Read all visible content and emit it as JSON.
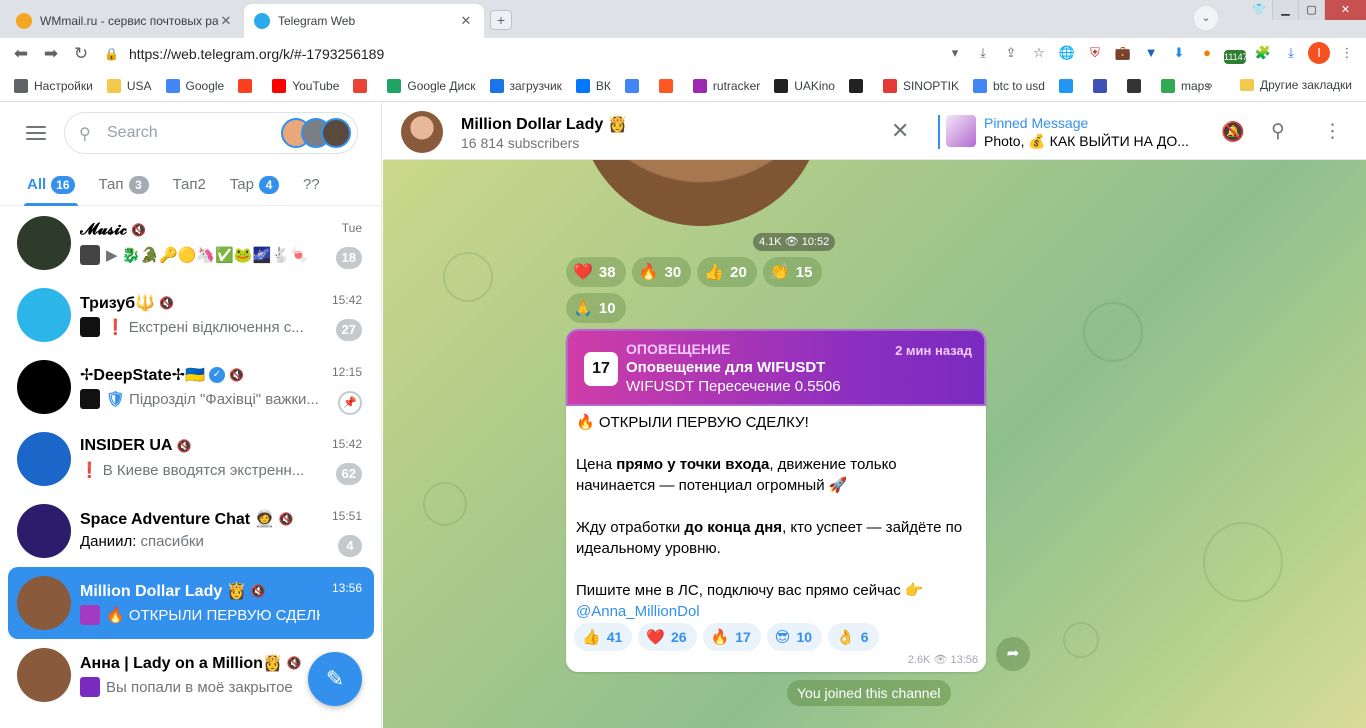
{
  "browser": {
    "tabs": [
      {
        "title": "WMmail.ru - сервис почтовых рас",
        "color": "#f5a623"
      },
      {
        "title": "Telegram Web",
        "color": "#2aabee"
      }
    ],
    "url": "https://web.telegram.org/k/#-1793256189",
    "ext_badge": "11147",
    "bookmarks": [
      {
        "label": "Настройки",
        "icon": "gear-icon",
        "color": "#5f6368"
      },
      {
        "label": "USA",
        "icon": "folder-icon",
        "color": "#f2c94c"
      },
      {
        "label": "Google",
        "icon": "google-icon",
        "color": "#4285f4"
      },
      {
        "label": "",
        "icon": "yandex-icon",
        "color": "#fc3f1d"
      },
      {
        "label": "YouTube",
        "icon": "youtube-icon",
        "color": "#ff0000"
      },
      {
        "label": "",
        "icon": "gmail-icon",
        "color": "#ea4335"
      },
      {
        "label": "Google Диск",
        "icon": "drive-icon",
        "color": "#1fa463"
      },
      {
        "label": "загрузчик",
        "icon": "loader-icon",
        "color": "#1a73e8"
      },
      {
        "label": "ВК",
        "icon": "vk-icon",
        "color": "#0077ff"
      },
      {
        "label": "",
        "icon": "translate-icon",
        "color": "#4285f4"
      },
      {
        "label": "",
        "icon": "f-icon",
        "color": "#ff5722"
      },
      {
        "label": "rutracker",
        "icon": "rutracker-icon",
        "color": "#9c27b0"
      },
      {
        "label": "UAKino",
        "icon": "film-icon",
        "color": "#222222"
      },
      {
        "label": "",
        "icon": "chess-icon",
        "color": "#222222"
      },
      {
        "label": "SINOPTIK",
        "icon": "thermo-icon",
        "color": "#e53935"
      },
      {
        "label": "btc to usd",
        "icon": "google-icon",
        "color": "#4285f4"
      },
      {
        "label": "",
        "icon": "p-icon",
        "color": "#2196f3"
      },
      {
        "label": "",
        "icon": "k-icon",
        "color": "#3f51b5"
      },
      {
        "label": "",
        "icon": "bc-icon",
        "color": "#333333"
      },
      {
        "label": "maps",
        "icon": "maps-icon",
        "color": "#34a853"
      }
    ],
    "more_label": "»",
    "other_bookmarks": "Другие закладки"
  },
  "sidebar": {
    "search_placeholder": "Search",
    "folders": [
      {
        "label": "All",
        "badge": "16",
        "active": true
      },
      {
        "label": "Тап",
        "badge": "3"
      },
      {
        "label": "Тап2",
        "badge": ""
      },
      {
        "label": "Tap",
        "badge": "4",
        "blue": true
      },
      {
        "label": "??",
        "badge": ""
      }
    ],
    "chats": [
      {
        "title": "𝓜𝓾𝓼𝓲𝓬",
        "time": "Tue",
        "subtitle": "▶ 🐉🐊🔑🟡🦄✅🐸🌌🐇🍬",
        "badge": "18",
        "avatar": "#2e3b2a",
        "thumb": "#444"
      },
      {
        "title": "Тризуб🔱",
        "time": "15:42",
        "subtitle": "Екстрені відключення с...",
        "prefix": "❗",
        "prefix_color": "blue",
        "badge": "27",
        "avatar": "#2cb5e8",
        "thumb": "#111"
      },
      {
        "title": "✢DeepState✢🇺🇦",
        "time": "12:15",
        "subtitle": "Підрозділ \"Фахівці\" важки...",
        "prefix": "🛡",
        "badge": "",
        "pinned": true,
        "verified": true,
        "avatar": "#000",
        "thumb": "#111"
      },
      {
        "title": "INSIDER UA",
        "time": "15:42",
        "subtitle": "В Киеве вводятся экстренн...",
        "prefix": "❗",
        "prefix_color": "red",
        "badge": "62",
        "avatar": "#1a66c9"
      },
      {
        "title": "Space Adventure Chat 🧑‍🚀",
        "time": "15:51",
        "sender": "Даниил:",
        "subtitle": "спасибки",
        "badge": "4",
        "avatar": "#2b1d6b"
      },
      {
        "title": "Million Dollar Lady 👸",
        "time": "13:56",
        "subtitle": "🔥 ОТКРЫЛИ ПЕРВУЮ СДЕЛКУ!...",
        "badge": "",
        "active": true,
        "avatar": "#8a5a3c",
        "thumb": "#a33bc2"
      },
      {
        "title": "Анна | Lady on a Million👸",
        "time": "",
        "subtitle": "Вы попали в моё закрытое",
        "badge": "",
        "avatar": "#8a5a3c",
        "thumb": "#7a2bbf"
      }
    ]
  },
  "channel": {
    "title": "Million Dollar Lady 👸",
    "subscribers": "16 814 subscribers",
    "pinned_label": "Pinned Message",
    "pinned_text": "Photo, 💰 КАК ВЫЙТИ НА ДО..."
  },
  "image_msg": {
    "views": "4.1K 👁 10:52",
    "reactions": [
      {
        "emoji": "❤️",
        "count": "38"
      },
      {
        "emoji": "🔥",
        "count": "30"
      },
      {
        "emoji": "👍",
        "count": "20"
      },
      {
        "emoji": "👏",
        "count": "15"
      },
      {
        "emoji": "🙏",
        "count": "10"
      }
    ]
  },
  "message": {
    "card_label": "ОПОВЕЩЕНИЕ",
    "card_time": "2 мин назад",
    "card_title": "Оповещение для WIFUSDT",
    "card_line": "WIFUSDT Пересечение 0.5506",
    "logo": "17",
    "line1": "🔥 ОТКРЫЛИ ПЕРВУЮ СДЕЛКУ!",
    "p2_a": "Цена ",
    "p2_b": "прямо у точки входа",
    "p2_c": ", движение только начинается — потенциал огромный 🚀",
    "p3_a": "Жду отработки ",
    "p3_b": "до конца дня",
    "p3_c": ", кто успеет — зайдёте по идеальному уровню.",
    "p4": "Пишите мне в ЛС, подключу вас прямо сейчас 👉",
    "link": "@Anna_MillionDol",
    "reactions": [
      {
        "emoji": "👍",
        "count": "41"
      },
      {
        "emoji": "❤️",
        "count": "26"
      },
      {
        "emoji": "🔥",
        "count": "17"
      },
      {
        "emoji": "😎",
        "count": "10"
      },
      {
        "emoji": "👌",
        "count": "6"
      }
    ],
    "meta": "2.6K 👁 13:56"
  },
  "service": {
    "joined": "You joined this channel"
  }
}
